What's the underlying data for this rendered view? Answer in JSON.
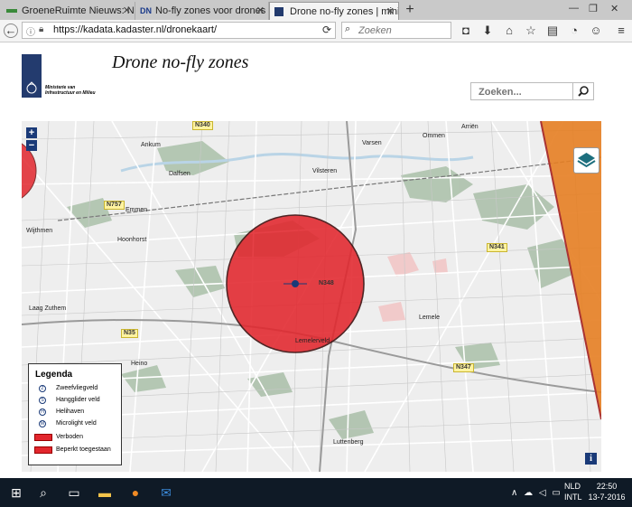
{
  "browser": {
    "tabs": [
      {
        "favicon": "groeneruimte-icon",
        "label": "GroeneRuimte Nieuws: No...",
        "active": false
      },
      {
        "favicon": "DN",
        "label": "No-fly zones voor drones ...",
        "active": false
      },
      {
        "favicon": "kadaster-icon",
        "label": "Drone no-fly zones | minis...",
        "active": true
      }
    ],
    "new_tab": "+",
    "url": "https://kadata.kadaster.nl/dronekaart/",
    "search_placeholder": "Zoeken"
  },
  "page": {
    "logo_text": "Ministerie van Infrastructuur en Milieu",
    "title": "Drone no-fly zones",
    "search_placeholder": "Zoeken...",
    "map": {
      "zoom_in": "+",
      "zoom_out": "−",
      "info": "i",
      "towns": [
        "Ankum",
        "Dalfsen",
        "Varsen",
        "Ommen",
        "Arriën",
        "Vilsteren",
        "Emmen",
        "Wijthmen",
        "Hoonhorst",
        "Laag Zuthem",
        "Heino",
        "Lemele",
        "Lemelerveld",
        "Luttenberg"
      ],
      "roads": [
        "N340",
        "N757",
        "N341",
        "N348",
        "N35",
        "N347"
      ],
      "legend": {
        "title": "Legenda",
        "items": [
          {
            "symbol": "Z",
            "label": "Zweefvliegveld"
          },
          {
            "symbol": "S",
            "label": "Hangglider veld"
          },
          {
            "symbol": "H",
            "label": "Helihaven"
          },
          {
            "symbol": "M",
            "label": "Microlight veld"
          },
          {
            "symbol": "box",
            "label": "Verboden",
            "color": "#e2262d"
          },
          {
            "symbol": "box",
            "label": "Beperkt toegestaan",
            "color": "#e2262d"
          }
        ]
      }
    }
  },
  "taskbar": {
    "lang": "NLD",
    "layout": "INTL",
    "time": "22:50",
    "date": "13-7-2016"
  }
}
